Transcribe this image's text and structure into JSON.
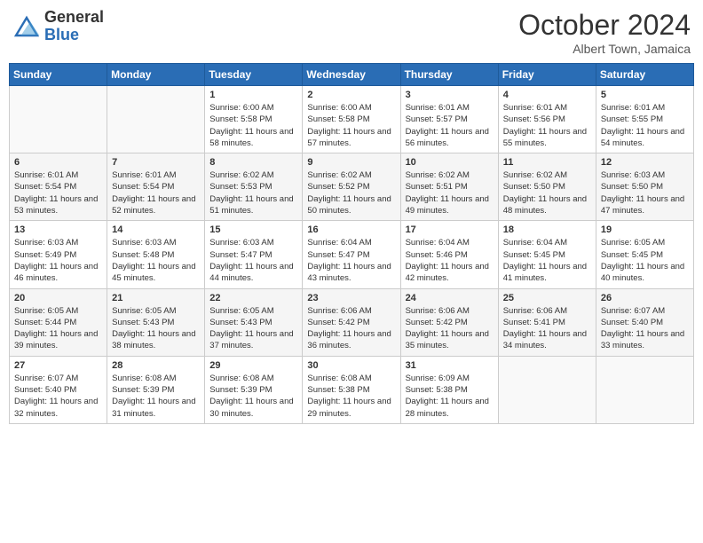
{
  "header": {
    "logo_general": "General",
    "logo_blue": "Blue",
    "month_title": "October 2024",
    "location": "Albert Town, Jamaica"
  },
  "days_of_week": [
    "Sunday",
    "Monday",
    "Tuesday",
    "Wednesday",
    "Thursday",
    "Friday",
    "Saturday"
  ],
  "weeks": [
    [
      {
        "day": "",
        "info": ""
      },
      {
        "day": "",
        "info": ""
      },
      {
        "day": "1",
        "info": "Sunrise: 6:00 AM\nSunset: 5:58 PM\nDaylight: 11 hours and 58 minutes."
      },
      {
        "day": "2",
        "info": "Sunrise: 6:00 AM\nSunset: 5:58 PM\nDaylight: 11 hours and 57 minutes."
      },
      {
        "day": "3",
        "info": "Sunrise: 6:01 AM\nSunset: 5:57 PM\nDaylight: 11 hours and 56 minutes."
      },
      {
        "day": "4",
        "info": "Sunrise: 6:01 AM\nSunset: 5:56 PM\nDaylight: 11 hours and 55 minutes."
      },
      {
        "day": "5",
        "info": "Sunrise: 6:01 AM\nSunset: 5:55 PM\nDaylight: 11 hours and 54 minutes."
      }
    ],
    [
      {
        "day": "6",
        "info": "Sunrise: 6:01 AM\nSunset: 5:54 PM\nDaylight: 11 hours and 53 minutes."
      },
      {
        "day": "7",
        "info": "Sunrise: 6:01 AM\nSunset: 5:54 PM\nDaylight: 11 hours and 52 minutes."
      },
      {
        "day": "8",
        "info": "Sunrise: 6:02 AM\nSunset: 5:53 PM\nDaylight: 11 hours and 51 minutes."
      },
      {
        "day": "9",
        "info": "Sunrise: 6:02 AM\nSunset: 5:52 PM\nDaylight: 11 hours and 50 minutes."
      },
      {
        "day": "10",
        "info": "Sunrise: 6:02 AM\nSunset: 5:51 PM\nDaylight: 11 hours and 49 minutes."
      },
      {
        "day": "11",
        "info": "Sunrise: 6:02 AM\nSunset: 5:50 PM\nDaylight: 11 hours and 48 minutes."
      },
      {
        "day": "12",
        "info": "Sunrise: 6:03 AM\nSunset: 5:50 PM\nDaylight: 11 hours and 47 minutes."
      }
    ],
    [
      {
        "day": "13",
        "info": "Sunrise: 6:03 AM\nSunset: 5:49 PM\nDaylight: 11 hours and 46 minutes."
      },
      {
        "day": "14",
        "info": "Sunrise: 6:03 AM\nSunset: 5:48 PM\nDaylight: 11 hours and 45 minutes."
      },
      {
        "day": "15",
        "info": "Sunrise: 6:03 AM\nSunset: 5:47 PM\nDaylight: 11 hours and 44 minutes."
      },
      {
        "day": "16",
        "info": "Sunrise: 6:04 AM\nSunset: 5:47 PM\nDaylight: 11 hours and 43 minutes."
      },
      {
        "day": "17",
        "info": "Sunrise: 6:04 AM\nSunset: 5:46 PM\nDaylight: 11 hours and 42 minutes."
      },
      {
        "day": "18",
        "info": "Sunrise: 6:04 AM\nSunset: 5:45 PM\nDaylight: 11 hours and 41 minutes."
      },
      {
        "day": "19",
        "info": "Sunrise: 6:05 AM\nSunset: 5:45 PM\nDaylight: 11 hours and 40 minutes."
      }
    ],
    [
      {
        "day": "20",
        "info": "Sunrise: 6:05 AM\nSunset: 5:44 PM\nDaylight: 11 hours and 39 minutes."
      },
      {
        "day": "21",
        "info": "Sunrise: 6:05 AM\nSunset: 5:43 PM\nDaylight: 11 hours and 38 minutes."
      },
      {
        "day": "22",
        "info": "Sunrise: 6:05 AM\nSunset: 5:43 PM\nDaylight: 11 hours and 37 minutes."
      },
      {
        "day": "23",
        "info": "Sunrise: 6:06 AM\nSunset: 5:42 PM\nDaylight: 11 hours and 36 minutes."
      },
      {
        "day": "24",
        "info": "Sunrise: 6:06 AM\nSunset: 5:42 PM\nDaylight: 11 hours and 35 minutes."
      },
      {
        "day": "25",
        "info": "Sunrise: 6:06 AM\nSunset: 5:41 PM\nDaylight: 11 hours and 34 minutes."
      },
      {
        "day": "26",
        "info": "Sunrise: 6:07 AM\nSunset: 5:40 PM\nDaylight: 11 hours and 33 minutes."
      }
    ],
    [
      {
        "day": "27",
        "info": "Sunrise: 6:07 AM\nSunset: 5:40 PM\nDaylight: 11 hours and 32 minutes."
      },
      {
        "day": "28",
        "info": "Sunrise: 6:08 AM\nSunset: 5:39 PM\nDaylight: 11 hours and 31 minutes."
      },
      {
        "day": "29",
        "info": "Sunrise: 6:08 AM\nSunset: 5:39 PM\nDaylight: 11 hours and 30 minutes."
      },
      {
        "day": "30",
        "info": "Sunrise: 6:08 AM\nSunset: 5:38 PM\nDaylight: 11 hours and 29 minutes."
      },
      {
        "day": "31",
        "info": "Sunrise: 6:09 AM\nSunset: 5:38 PM\nDaylight: 11 hours and 28 minutes."
      },
      {
        "day": "",
        "info": ""
      },
      {
        "day": "",
        "info": ""
      }
    ]
  ]
}
